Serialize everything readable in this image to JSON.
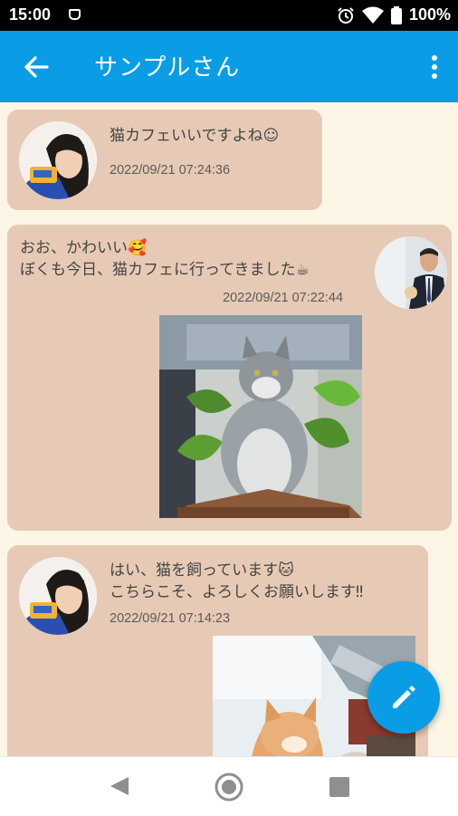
{
  "status_bar": {
    "time": "15:00",
    "battery": "100%"
  },
  "app_bar": {
    "title": "サンプルさん"
  },
  "messages": [
    {
      "text": "猫カフェいいですよね☺",
      "timestamp": "2022/09/21 07:24:36"
    },
    {
      "text": "おお、かわいい🥰\nぼくも今日、猫カフェに行ってきました☕",
      "timestamp": "2022/09/21 07:22:44"
    },
    {
      "text": "はい、猫を飼っています🐱\nこちらこそ、よろしくお願いします‼",
      "timestamp": "2022/09/21 07:14:23"
    }
  ],
  "colors": {
    "accent": "#0a9de6",
    "card": "#e7cab5",
    "background": "#fdf6e6"
  },
  "icons": [
    "back-arrow-icon",
    "more-vert-icon",
    "edit-pencil-icon",
    "nav-back-icon",
    "nav-home-icon",
    "nav-recent-icon",
    "wifi-icon",
    "alarm-icon",
    "battery-icon"
  ]
}
